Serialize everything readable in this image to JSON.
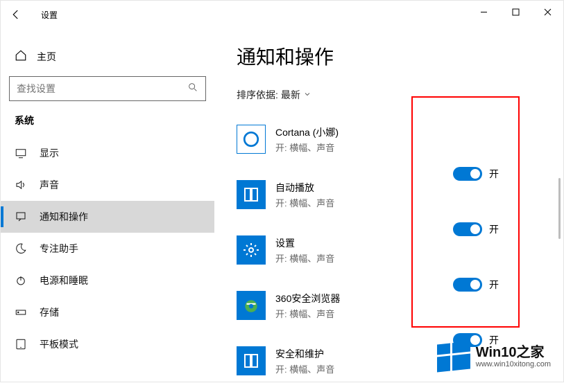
{
  "titlebar": {
    "title": "设置"
  },
  "sidebar": {
    "home": "主页",
    "search_placeholder": "查找设置",
    "category": "系统",
    "items": [
      {
        "label": "显示"
      },
      {
        "label": "声音"
      },
      {
        "label": "通知和操作"
      },
      {
        "label": "专注助手"
      },
      {
        "label": "电源和睡眠"
      },
      {
        "label": "存储"
      },
      {
        "label": "平板模式"
      }
    ]
  },
  "main": {
    "heading": "通知和操作",
    "sort_prefix": "排序依据: ",
    "sort_value": "最新",
    "apps": [
      {
        "name": "Cortana (小娜)",
        "sub": "开: 横幅、声音",
        "toggle": "开"
      },
      {
        "name": "自动播放",
        "sub": "开: 横幅、声音",
        "toggle": "开"
      },
      {
        "name": "设置",
        "sub": "开: 横幅、声音",
        "toggle": "开"
      },
      {
        "name": "360安全浏览器",
        "sub": "开: 横幅、声音",
        "toggle": "开"
      },
      {
        "name": "安全和维护",
        "sub": "开: 横幅、声音",
        "toggle": "开"
      }
    ]
  },
  "watermark": {
    "big": "Win10之家",
    "small": "www.win10xitong.com"
  }
}
